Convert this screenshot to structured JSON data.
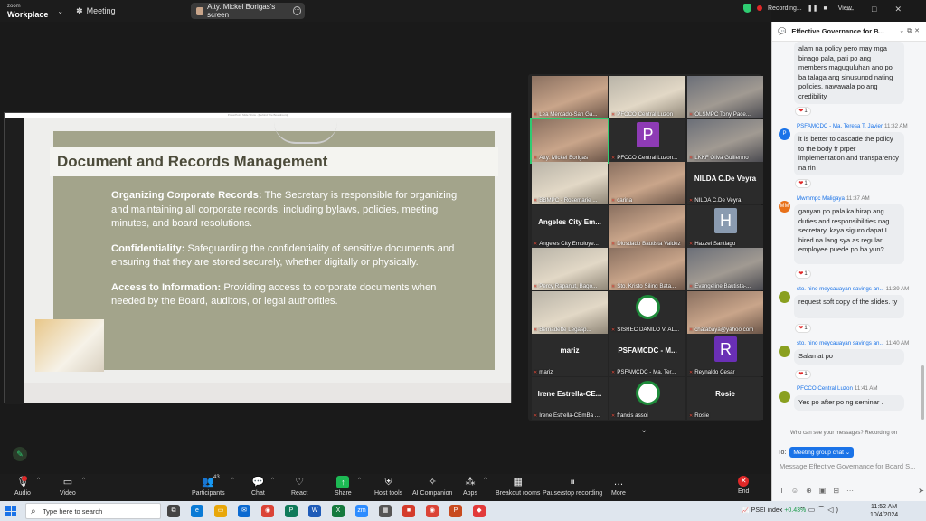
{
  "app": {
    "brand_top": "zoom",
    "brand_bottom": "Workplace",
    "meeting_label": "Meeting"
  },
  "screen_share_pill": "Atty. Mickel Borigas's screen",
  "top_right": {
    "recording": "Recording...",
    "view": "View"
  },
  "window_controls": [
    "—",
    "□",
    "✕"
  ],
  "share_window_title": "PowerPoint Slide Show - [Behind The Boardroom]",
  "slide": {
    "title": "Document and Records Management",
    "points": [
      {
        "head": "Organizing Corporate Records:",
        "text": " The Secretary is responsible for organizing and maintaining all corporate records, including bylaws, policies, meeting minutes, and board resolutions."
      },
      {
        "head": "Confidentiality:",
        "text": " Safeguarding the confidentiality of sensitive documents and ensuring that they are stored securely, whether digitally or physically."
      },
      {
        "head": "Access to Information:",
        "text": " Providing access to corporate documents when needed by the Board, auditors, or legal authorities."
      }
    ]
  },
  "gallery": [
    {
      "name": "Lea Mercado-San Ga...",
      "kind": "vid"
    },
    {
      "name": "PFCCO Central Luzon",
      "kind": "vid2"
    },
    {
      "name": "OLSMPC Tony Pace...",
      "kind": "vid3"
    },
    {
      "name": "Atty. Mickel Borigas",
      "kind": "vid",
      "active": true
    },
    {
      "name": "PFCCO Central Luzon...",
      "kind": "avatar",
      "letter": "P",
      "color": "#8e3bb5"
    },
    {
      "name": "LKKF Oliva Guillermo",
      "kind": "vid3"
    },
    {
      "name": "BBMPC - Rosemarie ...",
      "kind": "vid2"
    },
    {
      "name": "carina",
      "kind": "vid"
    },
    {
      "name": "NILDA C.De Veyra",
      "kind": "text",
      "big": "NILDA C.De Veyra"
    },
    {
      "name": "Angeles City Employe...",
      "kind": "text",
      "big": "Angeles City Em..."
    },
    {
      "name": "Diosdado Bautista Valdez",
      "kind": "vid"
    },
    {
      "name": "Hazzel Santiago",
      "kind": "avatar",
      "letter": "H",
      "color": "#8a9bb0"
    },
    {
      "name": "Percy Rapanut, Bago...",
      "kind": "vid2"
    },
    {
      "name": "Sto. Kristo Siling Bata...",
      "kind": "vid"
    },
    {
      "name": "Evangeline Bautista-...",
      "kind": "vid3"
    },
    {
      "name": "Bernadette Legasp...",
      "kind": "vid2"
    },
    {
      "name": "SISREC DANILO V. AL...",
      "kind": "seal"
    },
    {
      "name": "chatabaya@yahoo.com",
      "kind": "vid"
    },
    {
      "name": "mariz",
      "kind": "text",
      "big": "mariz"
    },
    {
      "name": "PSFAMCDC - Ma. Ter...",
      "kind": "text",
      "big": "PSFAMCDC - M..."
    },
    {
      "name": "Reynaldo Cesar",
      "kind": "avatar",
      "letter": "R",
      "color": "#6a2fb5"
    },
    {
      "name": "Irene Estrella-CEmBa ...",
      "kind": "text",
      "big": "Irene Estrella-CE..."
    },
    {
      "name": "francis assoi",
      "kind": "seal"
    },
    {
      "name": "Rosie",
      "kind": "text",
      "big": "Rosie"
    }
  ],
  "toolbar": [
    {
      "label": "Audio",
      "icon": "microphone-icon",
      "glyph": "🎙"
    },
    {
      "label": "Video",
      "icon": "camera-icon",
      "glyph": "▭"
    },
    {
      "label": "Participants",
      "icon": "participants-icon",
      "glyph": "👥",
      "count": "43"
    },
    {
      "label": "Chat",
      "icon": "chat-icon",
      "glyph": "💬"
    },
    {
      "label": "React",
      "icon": "heart-icon",
      "glyph": "♡"
    },
    {
      "label": "Share",
      "icon": "share-icon",
      "glyph": "↑"
    },
    {
      "label": "Host tools",
      "icon": "shield-icon",
      "glyph": "⛨"
    },
    {
      "label": "AI Companion",
      "icon": "sparkle-icon",
      "glyph": "✧"
    },
    {
      "label": "Apps",
      "icon": "apps-icon",
      "glyph": "⁂"
    },
    {
      "label": "Breakout rooms",
      "icon": "grid-icon",
      "glyph": "▦"
    },
    {
      "label": "Pause/stop recording",
      "icon": "record-icon",
      "glyph": "⏸"
    },
    {
      "label": "More",
      "icon": "more-icon",
      "glyph": "…"
    },
    {
      "label": "End",
      "icon": "end-icon",
      "glyph": "✕"
    }
  ],
  "chat": {
    "title": "Effective Governance for B...",
    "messages": [
      {
        "text": "alam na policy pero may mga binago pala, pati po ang members maguguluhan ano po ba talaga ang sinusunod nating policies. nawawala po ang credibility",
        "react": "1"
      },
      {
        "sender": "PSFAMCDC - Ma. Teresa T. Javier",
        "time": "11:32 AM",
        "avatar": "P",
        "text": "it is better to cascade the policy to the body fr prper implementation and transparency na rin",
        "react": "1"
      },
      {
        "sender": "Mwmmpc Maligaya",
        "time": "11:37 AM",
        "avatar": "MM",
        "text": "ganyan po pala ka hirap ang duties and responsibilities nag secretary, kaya siguro dapat  I hired na lang sya as regular employee puede po ba yun?",
        "react": "1"
      },
      {
        "sender": "sto. nino meycauayan savings an...",
        "time": "11:39 AM",
        "avatar": "",
        "text": "request soft copy of the slides. ty",
        "react": "1"
      },
      {
        "sender": "sto. nino meycauayan savings an...",
        "time": "11:40 AM",
        "avatar": "",
        "text": "Salamat po",
        "react": "1"
      },
      {
        "sender": "PFCCO Central Luzon",
        "time": "11:41 AM",
        "avatar": "",
        "text": "Yes po after po ng seminar ."
      }
    ],
    "who_can_see": "Who can see your messages? Recording on",
    "to_label": "To:",
    "to_target": "Meeting group chat",
    "input_placeholder": "Message Effective Governance for Board S..."
  },
  "taskbar": {
    "search": "Type here to search",
    "ticker_name": "PSEI index",
    "ticker_change": "+0.43%",
    "time": "11:52 AM",
    "date": "10/4/2024"
  }
}
